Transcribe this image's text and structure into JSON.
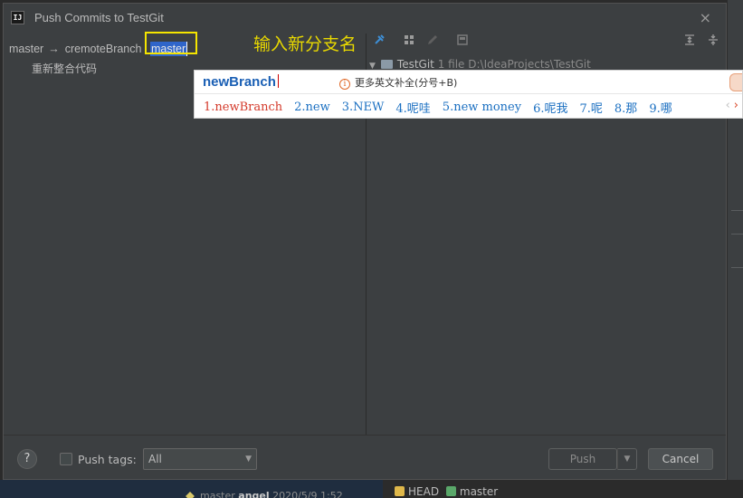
{
  "dialog": {
    "title": "Push Commits to TestGit",
    "close_icon": "×"
  },
  "branch_row": {
    "source": "master",
    "arrow": "→",
    "remote": "cremoteBranch",
    "separator": ":",
    "target_value": "master"
  },
  "annotation": "输入新分支名",
  "commits": [
    "重新整合代码"
  ],
  "tree": {
    "root": "TestGit",
    "meta": "1 file  D:\\IdeaProjects\\TestGit"
  },
  "ime": {
    "composition": "newBranch",
    "info_icon": "i",
    "info": "更多英文补全(分号+B)",
    "candidates": [
      "1.newBranch",
      "2.new",
      "3.NEW",
      "4.呢哇",
      "5.new money",
      "6.呢我",
      "7.呢",
      "8.那",
      "9.哪"
    ],
    "prev": "‹",
    "next": "›"
  },
  "footer": {
    "help": "?",
    "push_tags_label": "Push tags:",
    "push_tags_value": "All",
    "push": "Push",
    "cancel": "Cancel"
  },
  "background": {
    "log_branch": "master",
    "log_author": "angel",
    "log_date": "2020/5/9 1:52",
    "ref_head": "HEAD",
    "ref_master": "master"
  }
}
